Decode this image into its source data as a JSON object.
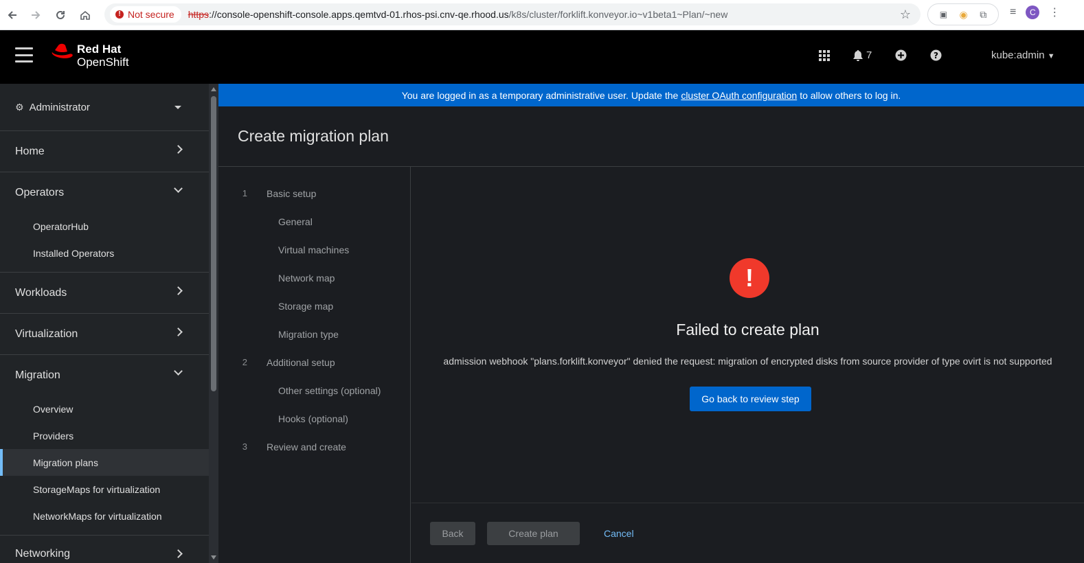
{
  "browser": {
    "security_label": "Not secure",
    "url_scheme": "https",
    "url_host": "://console-openshift-console.apps.qemtvd-01.rhos-psi.cnv-qe.rhood.us",
    "url_path": "/k8s/cluster/forklift.konveyor.io~v1beta1~Plan/~new",
    "profile_initial": "C"
  },
  "masthead": {
    "brand_line1": "Red Hat",
    "brand_line2": "OpenShift",
    "notification_count": "7",
    "user": "kube:admin"
  },
  "sidebar": {
    "perspective": "Administrator",
    "sections": [
      {
        "label": "Home",
        "expanded": false,
        "items": []
      },
      {
        "label": "Operators",
        "expanded": true,
        "items": [
          "OperatorHub",
          "Installed Operators"
        ]
      },
      {
        "label": "Workloads",
        "expanded": false,
        "items": []
      },
      {
        "label": "Virtualization",
        "expanded": false,
        "items": []
      },
      {
        "label": "Migration",
        "expanded": true,
        "items": [
          "Overview",
          "Providers",
          "Migration plans",
          "StorageMaps for virtualization",
          "NetworkMaps for virtualization"
        ]
      },
      {
        "label": "Networking",
        "expanded": false,
        "items": []
      }
    ],
    "active_item": "Migration plans"
  },
  "banner": {
    "prefix": "You are logged in as a temporary administrative user. Update the",
    "link": "cluster OAuth configuration",
    "suffix": "to allow others to log in."
  },
  "page": {
    "title": "Create migration plan"
  },
  "wizard": {
    "steps": [
      {
        "num": "1",
        "label": "Basic setup",
        "substeps": [
          "General",
          "Virtual machines",
          "Network map",
          "Storage map",
          "Migration type"
        ]
      },
      {
        "num": "2",
        "label": "Additional setup",
        "substeps": [
          "Other settings (optional)",
          "Hooks (optional)"
        ]
      },
      {
        "num": "3",
        "label": "Review and create",
        "substeps": []
      }
    ],
    "error": {
      "icon": "exclamation-circle-icon",
      "title": "Failed to create plan",
      "message": "admission webhook \"plans.forklift.konveyor\" denied the request: migration of encrypted disks from source provider of type ovirt is not supported",
      "button": "Go back to review step"
    },
    "footer": {
      "back": "Back",
      "create": "Create plan",
      "cancel": "Cancel"
    }
  },
  "colors": {
    "banner": "#0066cc",
    "primary_button": "#0066cc",
    "error_icon": "#f0392b",
    "link": "#73bcf7"
  }
}
